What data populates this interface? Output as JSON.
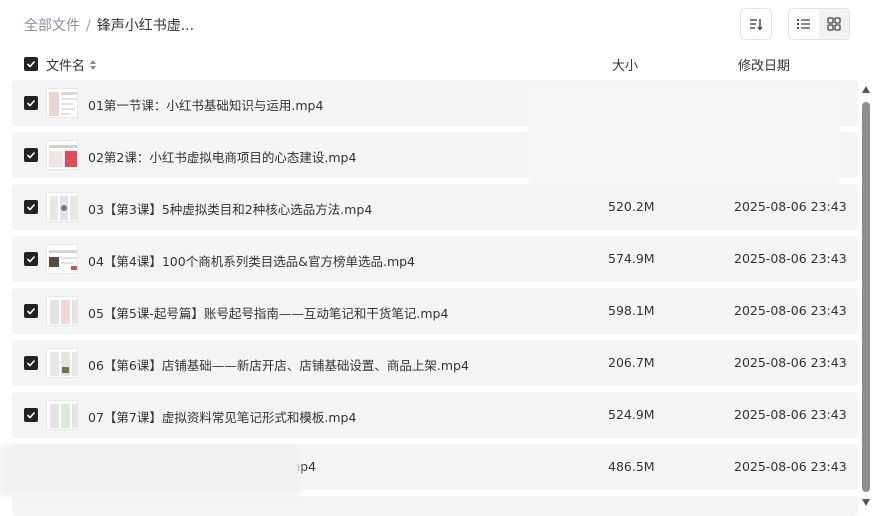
{
  "breadcrumb": {
    "root": "全部文件",
    "separator": "/",
    "current": "锋声小红书虚..."
  },
  "columns": {
    "name": "文件名",
    "size": "大小",
    "date": "修改日期"
  },
  "files": [
    {
      "name": "01第一节课：小红书基础知识与运用.mp4",
      "size": "",
      "date": "",
      "checked": true
    },
    {
      "name": "02第2课：小红书虚拟电商项目的心态建设.mp4",
      "size": "",
      "date": "",
      "checked": true
    },
    {
      "name": "03【第3课】5种虚拟类目和2种核心选品方法.mp4",
      "size": "520.2M",
      "date": "2025-08-06 23:43",
      "checked": true
    },
    {
      "name": "04【第4课】100个商机系列类目选品&官方榜单选品.mp4",
      "size": "574.9M",
      "date": "2025-08-06 23:43",
      "checked": true
    },
    {
      "name": "05【第5课-起号篇】账号起号指南——互动笔记和干货笔记.mp4",
      "size": "598.1M",
      "date": "2025-08-06 23:43",
      "checked": true
    },
    {
      "name": "06【第6课】店铺基础——新店开店、店铺基础设置、商品上架.mp4",
      "size": "206.7M",
      "date": "2025-08-06 23:43",
      "checked": true
    },
    {
      "name": "07【第7课】虚拟资料常见笔记形式和模板.mp4",
      "size": "524.9M",
      "date": "2025-08-06 23:43",
      "checked": true
    },
    {
      "name": "mp4",
      "size": "486.5M",
      "date": "2025-08-06 23:43",
      "checked": false
    }
  ]
}
